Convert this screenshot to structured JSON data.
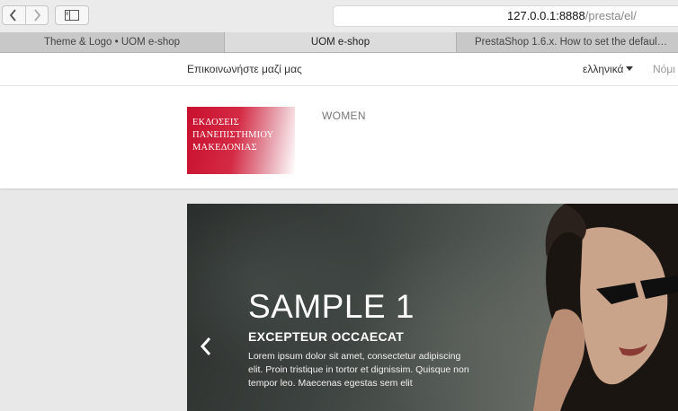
{
  "browser": {
    "url_host": "127.0.0.1:8888",
    "url_path": "/presta/el/",
    "tabs": [
      {
        "label": "Theme & Logo • UOM e-shop",
        "active": false
      },
      {
        "label": "UOM e-shop",
        "active": true
      },
      {
        "label": "PrestaShop 1.6.x. How to set the defaul…",
        "active": false
      }
    ]
  },
  "topbar": {
    "contact": "Επικοινωνήστε μαζί μας",
    "language": "ελληνικά",
    "currency": "Νόμι"
  },
  "header": {
    "logo_lines": [
      "ΕΚΔΟΣΕΙΣ",
      "ΠΑΝΕΠΙΣΤΗΜΙΟΥ",
      "ΜΑΚΕΔΟΝΙΑΣ"
    ],
    "menu": [
      "WOMEN"
    ]
  },
  "slider": {
    "title": "SAMPLE 1",
    "subtitle": "EXCEPTEUR OCCAECAT",
    "text": "Lorem ipsum dolor sit amet, consectetur adipiscing elit. Proin tristique in tortor et dignissim. Quisque non tempor leo. Maecenas egestas sem elit"
  },
  "colors": {
    "logo_red": "#c8102e",
    "page_bg": "#e8e8e8"
  }
}
